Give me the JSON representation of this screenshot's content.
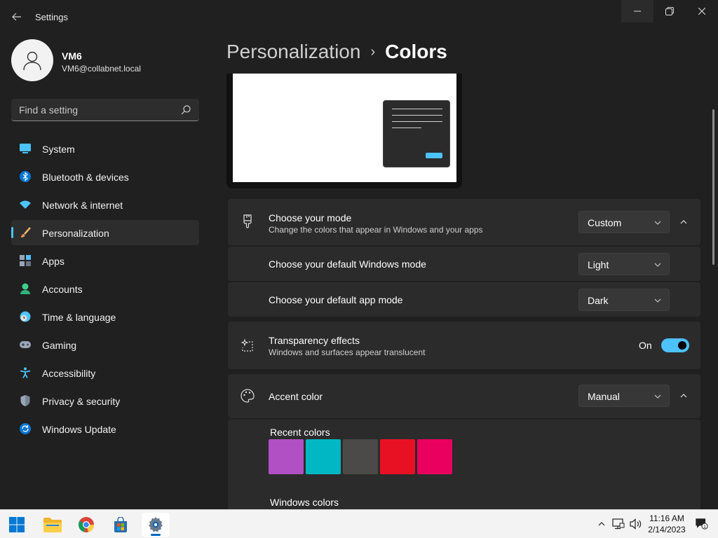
{
  "window": {
    "app_title": "Settings",
    "back_icon": "arrow-left-icon",
    "controls": [
      "minimize-icon",
      "maximize-icon",
      "close-icon"
    ]
  },
  "profile": {
    "name": "VM6",
    "email": "VM6@collabnet.local"
  },
  "search": {
    "placeholder": "Find a setting",
    "value": ""
  },
  "sidebar": {
    "items": [
      {
        "label": "System",
        "icon": "monitor-icon",
        "active": false
      },
      {
        "label": "Bluetooth & devices",
        "icon": "bluetooth-icon",
        "active": false
      },
      {
        "label": "Network & internet",
        "icon": "wifi-icon",
        "active": false
      },
      {
        "label": "Personalization",
        "icon": "paintbrush-icon",
        "active": true
      },
      {
        "label": "Apps",
        "icon": "apps-icon",
        "active": false
      },
      {
        "label": "Accounts",
        "icon": "person-icon",
        "active": false
      },
      {
        "label": "Time & language",
        "icon": "clock-globe-icon",
        "active": false
      },
      {
        "label": "Gaming",
        "icon": "gamepad-icon",
        "active": false
      },
      {
        "label": "Accessibility",
        "icon": "accessibility-icon",
        "active": false
      },
      {
        "label": "Privacy & security",
        "icon": "shield-icon",
        "active": false
      },
      {
        "label": "Windows Update",
        "icon": "update-icon",
        "active": false
      }
    ]
  },
  "breadcrumb": {
    "parent": "Personalization",
    "separator": "›",
    "current": "Colors"
  },
  "mode_card": {
    "title": "Choose your mode",
    "subtitle": "Change the colors that appear in Windows and your apps",
    "value": "Custom",
    "windows_mode_label": "Choose your default Windows mode",
    "windows_mode_value": "Light",
    "app_mode_label": "Choose your default app mode",
    "app_mode_value": "Dark"
  },
  "transparency": {
    "title": "Transparency effects",
    "subtitle": "Windows and surfaces appear translucent",
    "state_label": "On",
    "on": true
  },
  "accent": {
    "title": "Accent color",
    "value": "Manual",
    "recent_label": "Recent colors",
    "recent_colors": [
      "#b14fc4",
      "#00b7c3",
      "#4c4a48",
      "#e81123",
      "#ea005e"
    ],
    "windows_label": "Windows colors",
    "windows_colors": [
      "#ffb900",
      "#ff8c00",
      "#f7630c",
      "#ca5010",
      "#da3b01",
      "#ef6950",
      "#d13438",
      "#ff4343",
      "#e74856"
    ]
  },
  "colors": {
    "accent": "#4cc2ff",
    "background": "#202020",
    "card": "#2b2b2b"
  },
  "taskbar": {
    "apps": [
      "windows-start-icon",
      "file-explorer-icon",
      "chrome-icon",
      "microsoft-store-icon",
      "settings-gear-icon"
    ],
    "tray": [
      "chevron-up-icon",
      "network-icon",
      "volume-icon"
    ],
    "time": "11:16 AM",
    "date": "2/14/2023",
    "notification_count": "1"
  }
}
